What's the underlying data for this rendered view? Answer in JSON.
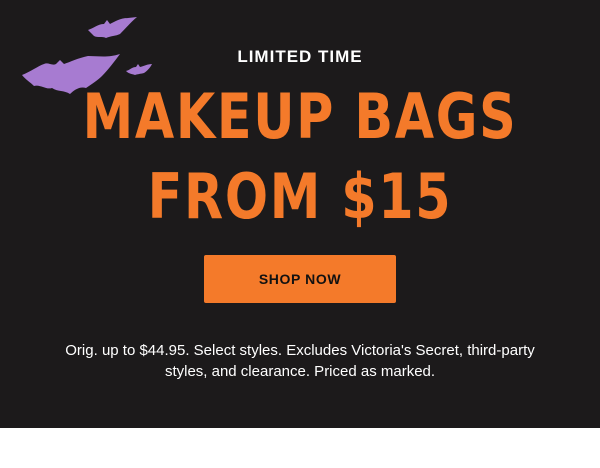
{
  "promo": {
    "eyebrow": "LIMITED TIME",
    "headline_line1": "MAKEUP BAGS",
    "headline_line2": "FROM $15",
    "cta_label": "SHOP NOW",
    "disclaimer_line1": "Orig. up to $44.95. Select styles. Excludes Victoria's Secret, third-party",
    "disclaimer_line2": "styles, and clearance. Priced as marked."
  },
  "icons": [
    "bat-icon",
    "bat-icon",
    "bat-icon"
  ],
  "colors": {
    "background": "#1c1a1b",
    "accent": "#f47a2a",
    "bat": "#a77bd1",
    "text": "#ffffff"
  }
}
